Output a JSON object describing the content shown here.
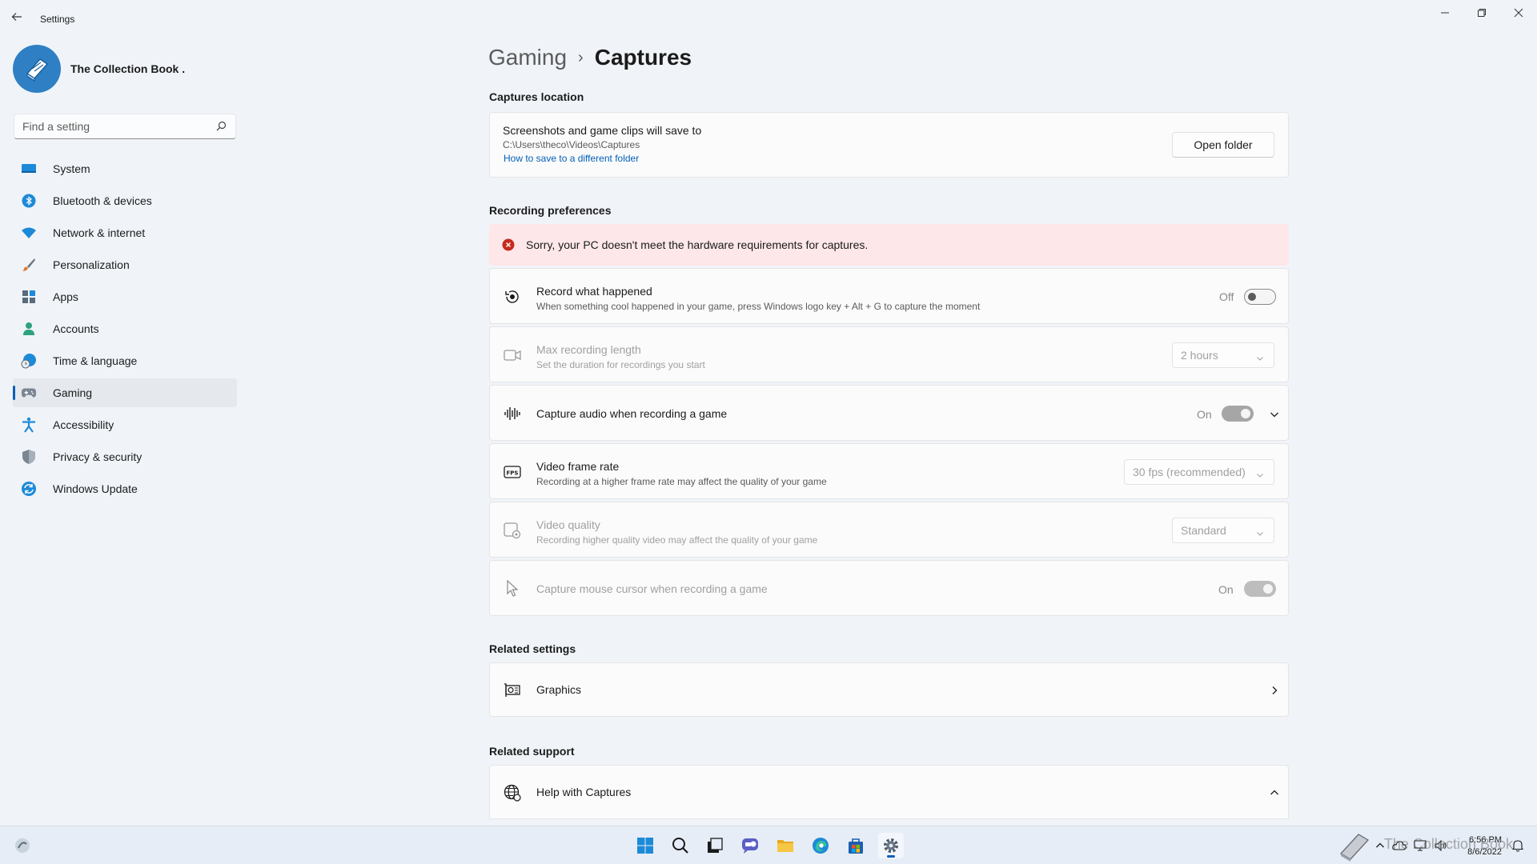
{
  "window": {
    "title": "Settings",
    "back_label": "←"
  },
  "profile": {
    "name": "The Collection Book ."
  },
  "search": {
    "placeholder": "Find a setting"
  },
  "nav": {
    "items": [
      {
        "label": "System",
        "icon": "system-icon",
        "color": "#0078d4"
      },
      {
        "label": "Bluetooth & devices",
        "icon": "bluetooth-icon",
        "color": "#0078d4"
      },
      {
        "label": "Network & internet",
        "icon": "wifi-icon",
        "color": "#0078d4"
      },
      {
        "label": "Personalization",
        "icon": "brush-icon",
        "color": "#e07b39"
      },
      {
        "label": "Apps",
        "icon": "apps-icon",
        "color": "#5a6b7b"
      },
      {
        "label": "Accounts",
        "icon": "person-icon",
        "color": "#2ea17d"
      },
      {
        "label": "Time & language",
        "icon": "globe-clock-icon",
        "color": "#0078d4"
      },
      {
        "label": "Gaming",
        "icon": "controller-icon",
        "color": "#6b7685"
      },
      {
        "label": "Accessibility",
        "icon": "accessibility-icon",
        "color": "#0078d4"
      },
      {
        "label": "Privacy & security",
        "icon": "shield-icon",
        "color": "#6b7685"
      },
      {
        "label": "Windows Update",
        "icon": "update-icon",
        "color": "#0078d4"
      }
    ],
    "active": "Gaming"
  },
  "breadcrumb": {
    "parent": "Gaming",
    "separator": "›",
    "current": "Captures"
  },
  "captures_location": {
    "section_title": "Captures location",
    "title": "Screenshots and game clips will save to",
    "path": "C:\\Users\\theco\\Videos\\Captures",
    "link": "How to save to a different folder",
    "button": "Open folder"
  },
  "recording": {
    "section_title": "Recording preferences",
    "alert": "Sorry, your PC doesn't meet the hardware requirements for captures.",
    "record_what_happened": {
      "title": "Record what happened",
      "subtitle": "When something cool happened in your game, press Windows logo key + Alt + G to capture the moment",
      "state_label": "Off",
      "enabled": false
    },
    "max_length": {
      "title": "Max recording length",
      "subtitle": "Set the duration for recordings you start",
      "value": "2 hours"
    },
    "capture_audio": {
      "title": "Capture audio when recording a game",
      "state_label": "On",
      "enabled": true
    },
    "frame_rate": {
      "title": "Video frame rate",
      "subtitle": "Recording at a higher frame rate may affect the quality of your game",
      "value": "30 fps (recommended)"
    },
    "video_quality": {
      "title": "Video quality",
      "subtitle": "Recording higher quality video may affect the quality of your game",
      "value": "Standard"
    },
    "mouse_cursor": {
      "title": "Capture mouse cursor when recording a game",
      "state_label": "On",
      "enabled": true
    }
  },
  "related_settings": {
    "section_title": "Related settings",
    "graphics": "Graphics"
  },
  "related_support": {
    "section_title": "Related support",
    "help": "Help with Captures"
  },
  "taskbar": {
    "clock_time": "6:56 PM",
    "clock_date": "8/6/2022",
    "watermark": "The Collection Book"
  },
  "colors": {
    "accent": "#005fb8",
    "error": "#c42b1c",
    "alert_bg": "#fde7e9"
  }
}
